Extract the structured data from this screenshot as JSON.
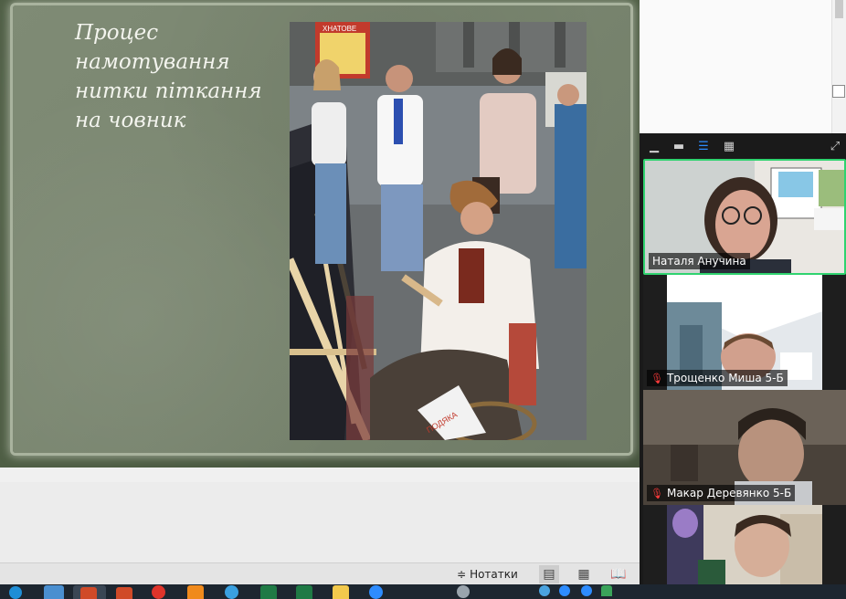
{
  "slide": {
    "title": "Процес\nнамотування\nнитки  піткання\nна човник",
    "photo_sign_text": "ХНАТОВЕ",
    "photo_gift_text": "ПОДЯКА"
  },
  "statusbar": {
    "notes_label": "Нотатки",
    "icons": [
      "notes-icon",
      "normal-view-icon",
      "slide-sorter-icon",
      "reading-view-icon"
    ]
  },
  "zoom": {
    "toolbar_icons": [
      "minimize-icon",
      "thumbnail-view-icon",
      "speaker-view-icon",
      "gallery-view-icon",
      "fullscreen-icon"
    ],
    "participants": [
      {
        "name": "Наталя Анучина",
        "muted": false,
        "active": true
      },
      {
        "name": "Трощенко Миша 5-Б",
        "muted": true,
        "active": false
      },
      {
        "name": "Макар Деревянко 5-Б",
        "muted": true,
        "active": false
      },
      {
        "name": "",
        "muted": false,
        "active": false
      }
    ]
  },
  "taskbar": {
    "apps": [
      "edge-icon",
      "explorer-icon",
      "powerpoint-icon",
      "powerpoint-icon-2",
      "chrome-icon",
      "draw-icon",
      "globe-icon",
      "excel-icon",
      "excel-icon-2",
      "folder-icon",
      "zoom-icon",
      "system-tray"
    ]
  }
}
